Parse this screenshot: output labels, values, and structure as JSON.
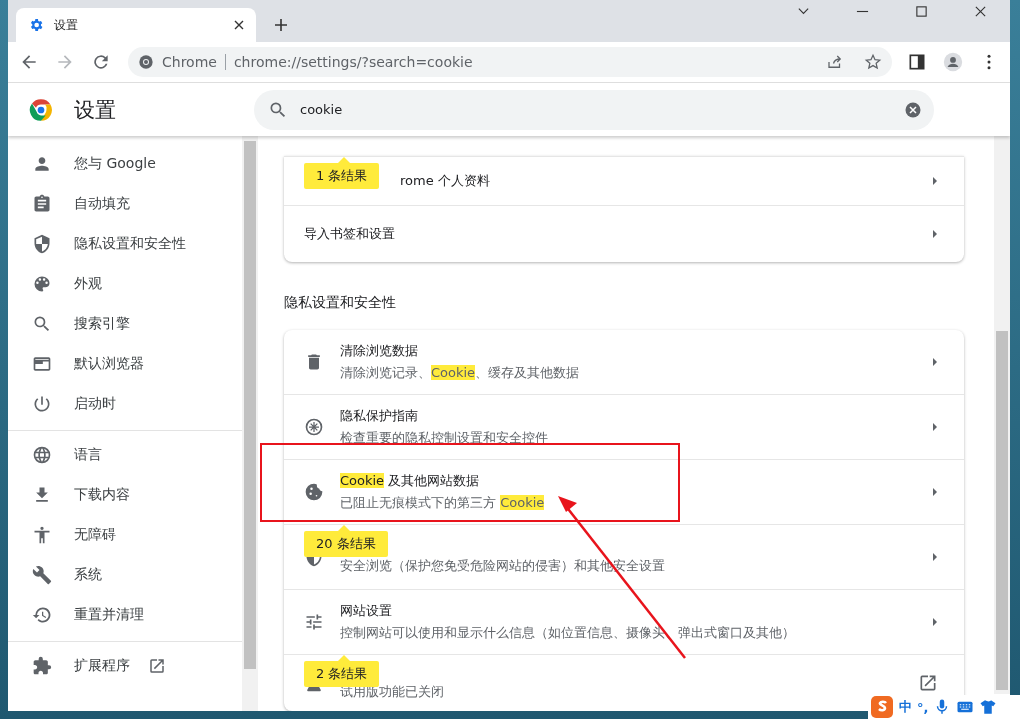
{
  "browser": {
    "tab_title": "设置",
    "address_site": "Chrome",
    "address_url": "chrome://settings/?search=cookie"
  },
  "header": {
    "title": "设置",
    "search_value": "cookie"
  },
  "sidebar": {
    "groups": [
      {
        "items": [
          {
            "label": "您与 Google"
          },
          {
            "label": "自动填充"
          },
          {
            "label": "隐私设置和安全性"
          },
          {
            "label": "外观"
          },
          {
            "label": "搜索引擎"
          },
          {
            "label": "默认浏览器"
          },
          {
            "label": "启动时"
          }
        ]
      },
      {
        "items": [
          {
            "label": "语言"
          },
          {
            "label": "下载内容"
          },
          {
            "label": "无障碍"
          },
          {
            "label": "系统"
          },
          {
            "label": "重置并清理"
          }
        ]
      },
      {
        "items": [
          {
            "label": "扩展程序",
            "external": true
          }
        ]
      }
    ]
  },
  "sections": [
    {
      "rows": [
        {
          "title": "rome 个人资料",
          "kind": "arrow",
          "bubble": "1 条结果"
        },
        {
          "title": "导入书签和设置",
          "kind": "arrow"
        }
      ]
    },
    {
      "heading": "隐私设置和安全性",
      "rows": [
        {
          "title": "清除浏览数据",
          "subtitle": [
            {
              "text": "清除浏览记录、",
              "highlight": false
            },
            {
              "text": "Cookie",
              "highlight": true
            },
            {
              "text": "、缓存及其他数据",
              "highlight": false
            }
          ],
          "kind": "arrow"
        },
        {
          "title": "隐私保护指南",
          "subtitle": [
            {
              "text": "检查重要的隐私控制设置和安全控件",
              "highlight": false
            }
          ],
          "kind": "arrow"
        },
        {
          "title_parts": [
            {
              "text": "Cookie",
              "highlight": true
            },
            {
              "text": " 及其他网站数据",
              "highlight": false
            }
          ],
          "subtitle": [
            {
              "text": "已阻止无痕模式下的第三方 ",
              "highlight": false
            },
            {
              "text": "Cookie",
              "highlight": true
            }
          ],
          "kind": "arrow"
        },
        {
          "subtitle": [
            {
              "text": "安全浏览（保护您免受危险网站的侵害）和其他安全设置",
              "highlight": false
            }
          ],
          "kind": "arrow",
          "bubble": "20 条结果"
        },
        {
          "title": "网站设置",
          "subtitle": [
            {
              "text": "控制网站可以使用和显示什么信息（如位置信息、摄像头、弹出式窗口及其他）",
              "highlight": false
            }
          ],
          "kind": "arrow"
        },
        {
          "subtitle": [
            {
              "text": "试用版功能已关闭",
              "highlight": false
            }
          ],
          "kind": "external",
          "bubble": "2 条结果"
        }
      ]
    }
  ],
  "ime": {
    "mode": "中",
    "punct": "°,"
  }
}
